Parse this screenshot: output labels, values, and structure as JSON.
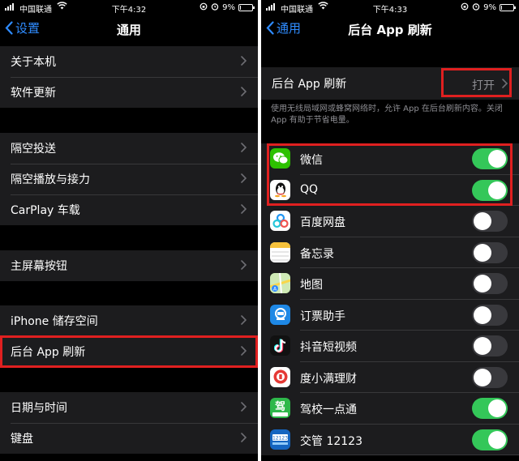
{
  "status": {
    "carrier": "中国联通",
    "left_time": "下午4:32",
    "right_time": "下午4:33",
    "battery": "9%",
    "battery_level": 0.09
  },
  "left": {
    "back_label": "设置",
    "title": "通用",
    "groups": [
      [
        "关于本机",
        "软件更新"
      ],
      [
        "隔空投送",
        "隔空播放与接力",
        "CarPlay 车载"
      ],
      [
        "主屏幕按钮"
      ],
      [
        "iPhone 储存空间",
        "后台 App 刷新"
      ],
      [
        "日期与时间",
        "键盘"
      ]
    ]
  },
  "right": {
    "back_label": "通用",
    "title": "后台 App 刷新",
    "setting_label": "后台 App 刷新",
    "setting_value": "打开",
    "footnote": "使用无线局域网或蜂窝网络时，允许 App 在后台刷新内容。关闭 App 有助于节省电量。",
    "apps": [
      {
        "name": "微信",
        "on": true,
        "icon": "wechat-icon",
        "color": "#2dc100"
      },
      {
        "name": "QQ",
        "on": true,
        "icon": "qq-icon",
        "color": "#ffffff"
      },
      {
        "name": "百度网盘",
        "on": false,
        "icon": "baidu-netdisk-icon",
        "color": "#ffffff"
      },
      {
        "name": "备忘录",
        "on": false,
        "icon": "notes-icon",
        "color": "#ffffff"
      },
      {
        "name": "地图",
        "on": false,
        "icon": "maps-icon",
        "color": "#6cc24a"
      },
      {
        "name": "订票助手",
        "on": false,
        "icon": "ticket-icon",
        "color": "#1e88e5"
      },
      {
        "name": "抖音短视频",
        "on": false,
        "icon": "douyin-icon",
        "color": "#111111"
      },
      {
        "name": "度小满理财",
        "on": false,
        "icon": "duxiaoman-icon",
        "color": "#ffffff"
      },
      {
        "name": "驾校一点通",
        "on": true,
        "icon": "jiaxiao-icon",
        "color": "#2eb84a"
      },
      {
        "name": "交管 12123",
        "on": true,
        "icon": "jiaoguan-icon",
        "color": "#1565c0"
      }
    ]
  },
  "accent_color": "#2f8cff",
  "highlight_color": "#e02020"
}
